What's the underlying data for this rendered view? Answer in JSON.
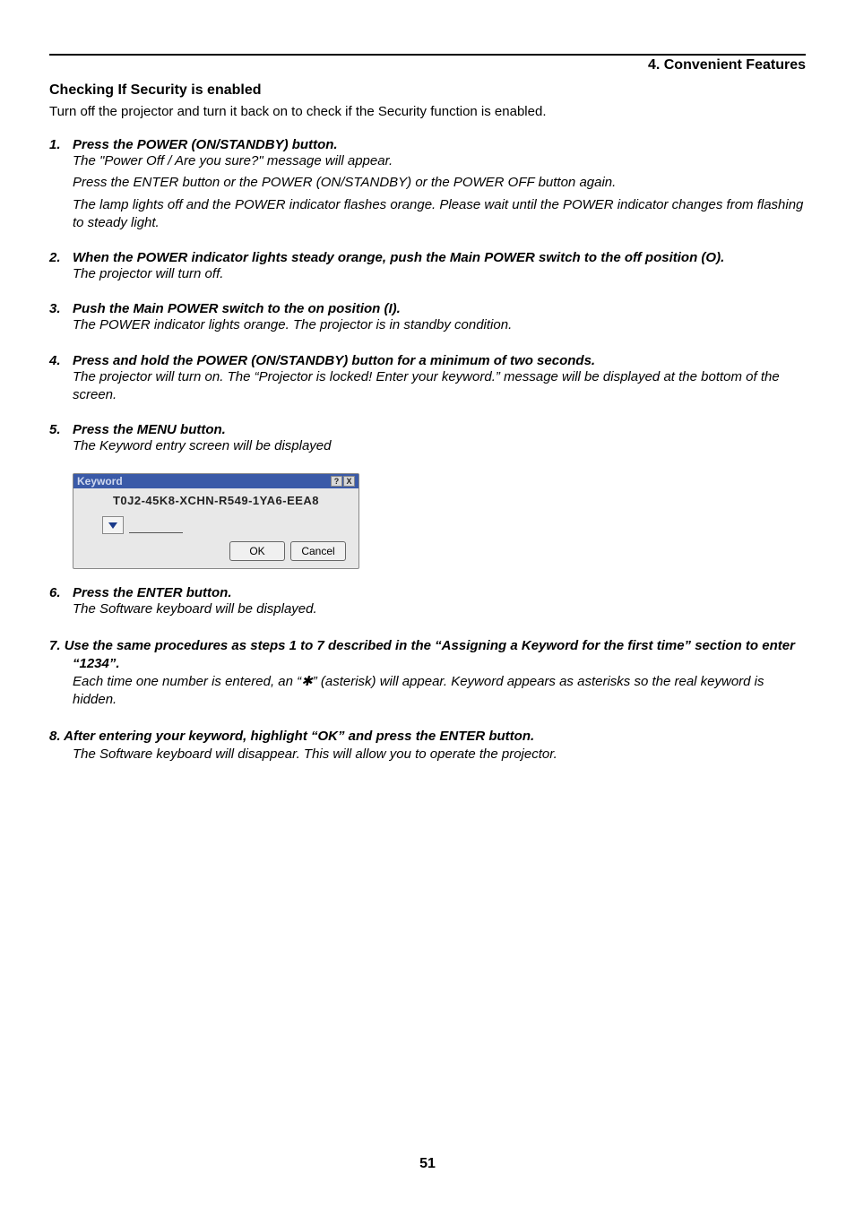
{
  "header": {
    "section": "4. Convenient Features"
  },
  "title": "Checking If Security is enabled",
  "intro": "Turn off the projector and turn it back on to check if the Security function is enabled.",
  "steps": {
    "s1": {
      "num": "1.",
      "head": "Press the POWER (ON/STANDBY) button.",
      "p1": "The \"Power Off / Are you sure?\" message will appear.",
      "p2": "Press the ENTER button or the POWER (ON/STANDBY) or the POWER OFF button again.",
      "p3": "The lamp lights off and the POWER indicator flashes orange. Please wait until the POWER indicator changes from flashing to steady light."
    },
    "s2": {
      "num": "2.",
      "head": "When the POWER indicator lights steady orange, push the Main POWER switch to the off position (O).",
      "p1": "The projector will turn off."
    },
    "s3": {
      "num": "3.",
      "head": "Push the Main POWER switch to the on position (I).",
      "p1": "The POWER indicator lights orange. The projector is in standby condition."
    },
    "s4": {
      "num": "4.",
      "head": "Press and hold the POWER (ON/STANDBY) button for a minimum of two seconds.",
      "p1": "The projector will turn on. The “Projector is locked! Enter your keyword.” message will be displayed at the bottom of the screen."
    },
    "s5": {
      "num": "5.",
      "head": "Press the MENU button.",
      "p1": "The Keyword entry screen will be displayed"
    },
    "s6": {
      "num": "6.",
      "head": "Press the ENTER button.",
      "p1": "The Software keyboard will be displayed."
    },
    "s7": {
      "num": "7.",
      "head": "Use the same procedures as steps 1 to 7 described in the “Assigning a Keyword for the first time” section to enter “1234”.",
      "p1": "Each time one number is entered, an “✱” (asterisk) will appear. Keyword appears as asterisks so the real keyword is hidden."
    },
    "s8": {
      "num": "8.",
      "head": "After entering your keyword, highlight “OK” and press the ENTER button.",
      "p1": "The Software keyboard will disappear. This will allow you to operate the projector."
    }
  },
  "dialog": {
    "title": "Keyword",
    "help": "?",
    "close": "X",
    "serial": "T0J2-45K8-XCHN-R549-1YA6-EEA8",
    "ok": "OK",
    "cancel": "Cancel"
  },
  "pageNumber": "51"
}
